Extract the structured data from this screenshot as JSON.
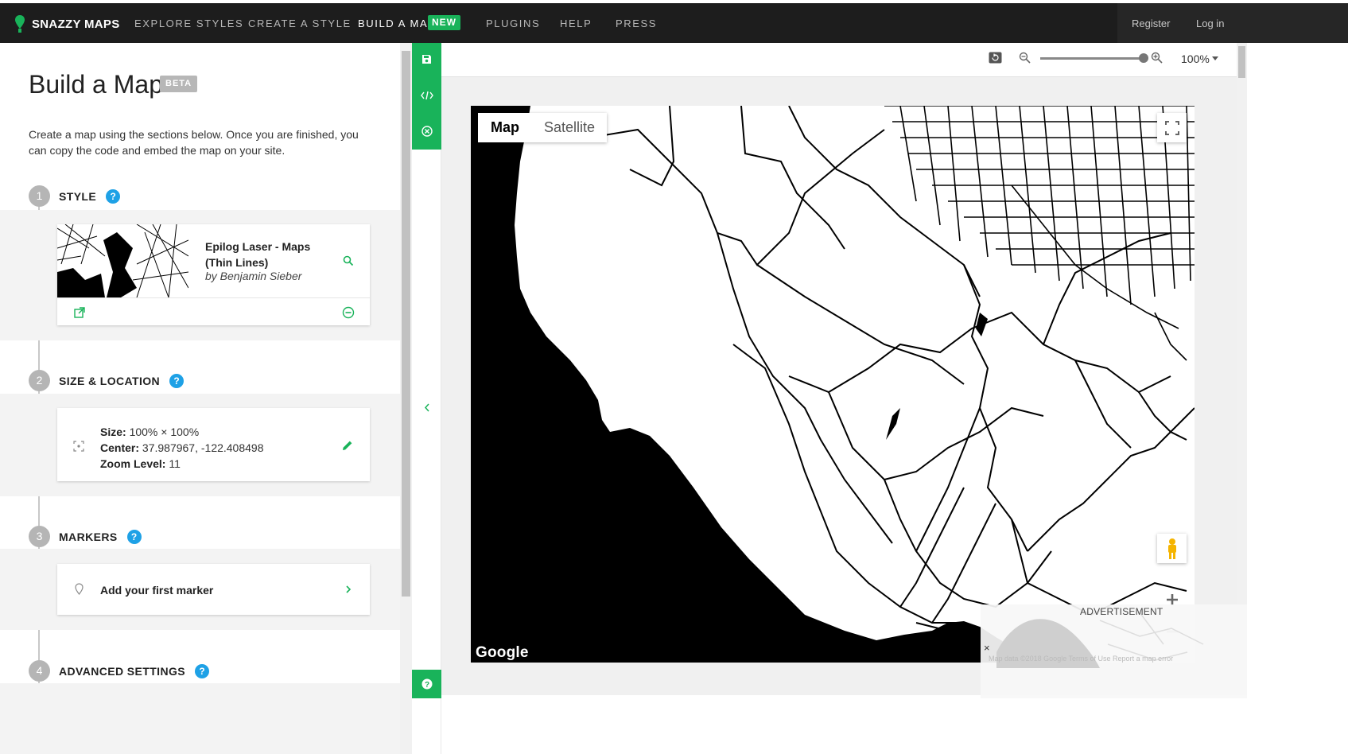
{
  "nav": {
    "logo_text": "SNAZZY MAPS",
    "items": [
      "EXPLORE STYLES",
      "CREATE A STYLE",
      "BUILD A MAP",
      "PLUGINS",
      "HELP",
      "PRESS"
    ],
    "new_badge": "NEW",
    "register": "Register",
    "login": "Log in",
    "accent_color": "#19b35a"
  },
  "builder": {
    "title": "Build a Map",
    "beta_badge": "BETA",
    "intro": "Create a map using the sections below. Once you are finished, you can copy the code and embed the map on your site.",
    "steps": [
      {
        "number": "1",
        "label": "STYLE"
      },
      {
        "number": "2",
        "label": "SIZE & LOCATION"
      },
      {
        "number": "3",
        "label": "MARKERS"
      },
      {
        "number": "4",
        "label": "ADVANCED SETTINGS"
      }
    ],
    "help_icon": "?",
    "style_card": {
      "name": "Epilog Laser - Maps (Thin Lines)",
      "author": "by Benjamin Sieber",
      "icons": [
        "search-icon",
        "external-link-icon",
        "remove-icon"
      ]
    },
    "size_card": {
      "size_label": "Size:",
      "size_value": "100% × 100%",
      "center_label": "Center:",
      "center_value": "37.987967, -122.408498",
      "zoom_label": "Zoom Level:",
      "zoom_value": "11",
      "icons": [
        "focus-icon",
        "edit-pencil-icon"
      ]
    },
    "markers_card": {
      "label": "Add your first marker",
      "icons": [
        "map-pin-icon",
        "chevron-right-icon"
      ]
    }
  },
  "sidebar_tools": [
    "save-icon",
    "code-icon",
    "close-circle-icon",
    "collapse-chevron-icon",
    "help-icon"
  ],
  "map_toolbar": {
    "zoom_level": "100%",
    "zoom_slider_fraction": 1.0,
    "icons": [
      "reset-icon",
      "zoom-out-icon",
      "zoom-in-icon",
      "dropdown-icon"
    ]
  },
  "map": {
    "type_options": [
      "Map",
      "Satellite"
    ],
    "selected_type": "Map",
    "google_logo": "Google",
    "controls": [
      "fullscreen-icon",
      "pegman-icon",
      "zoom-in-plus-icon",
      "zoom-out-minus-icon"
    ],
    "ad_label": "ADVERTISEMENT",
    "ad_close": "×",
    "footer": "Map data ©2018 Google  Terms of Use  Report a map error"
  }
}
